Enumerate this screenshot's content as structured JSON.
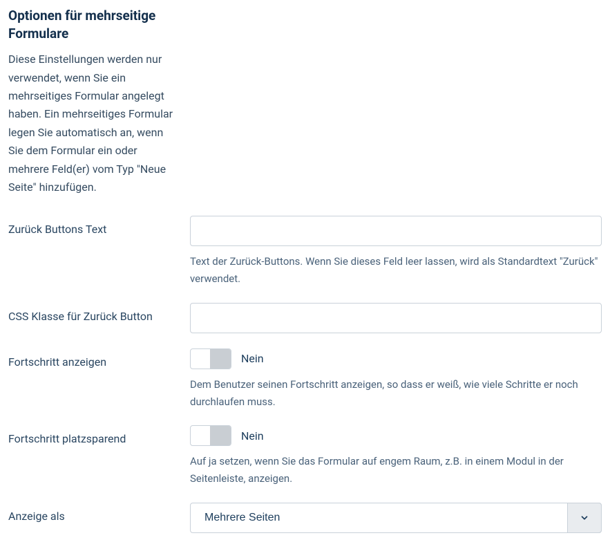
{
  "section": {
    "title": "Optionen für mehrseitige Formulare",
    "description": "Diese Einstellungen werden nur verwendet, wenn Sie ein mehrseitiges Formular angelegt haben. Ein mehrseitiges Formular legen Sie automatisch an, wenn Sie dem Formular ein oder mehrere Feld(er) vom Typ \"Neue Seite\" hinzufügen."
  },
  "fields": {
    "back_button_text": {
      "label": "Zurück Buttons Text",
      "value": "",
      "help": "Text der Zurück-Buttons. Wenn Sie dieses Feld leer lassen, wird als Standardtext \"Zurück\" verwendet."
    },
    "back_button_css": {
      "label": "CSS Klasse für Zurück Button",
      "value": ""
    },
    "show_progress": {
      "label": "Fortschritt anzeigen",
      "state_label": "Nein",
      "help": "Dem Benutzer seinen Fortschritt anzeigen, so dass er weiß, wie viele Schritte er noch durchlaufen muss."
    },
    "compact_progress": {
      "label": "Fortschritt platzsparend",
      "state_label": "Nein",
      "help": "Auf ja setzen, wenn Sie das Formular auf engem Raum, z.B. in einem Modul in der Seitenleiste, anzeigen."
    },
    "display_as": {
      "label": "Anzeige als",
      "selected": "Mehrere Seiten"
    }
  }
}
